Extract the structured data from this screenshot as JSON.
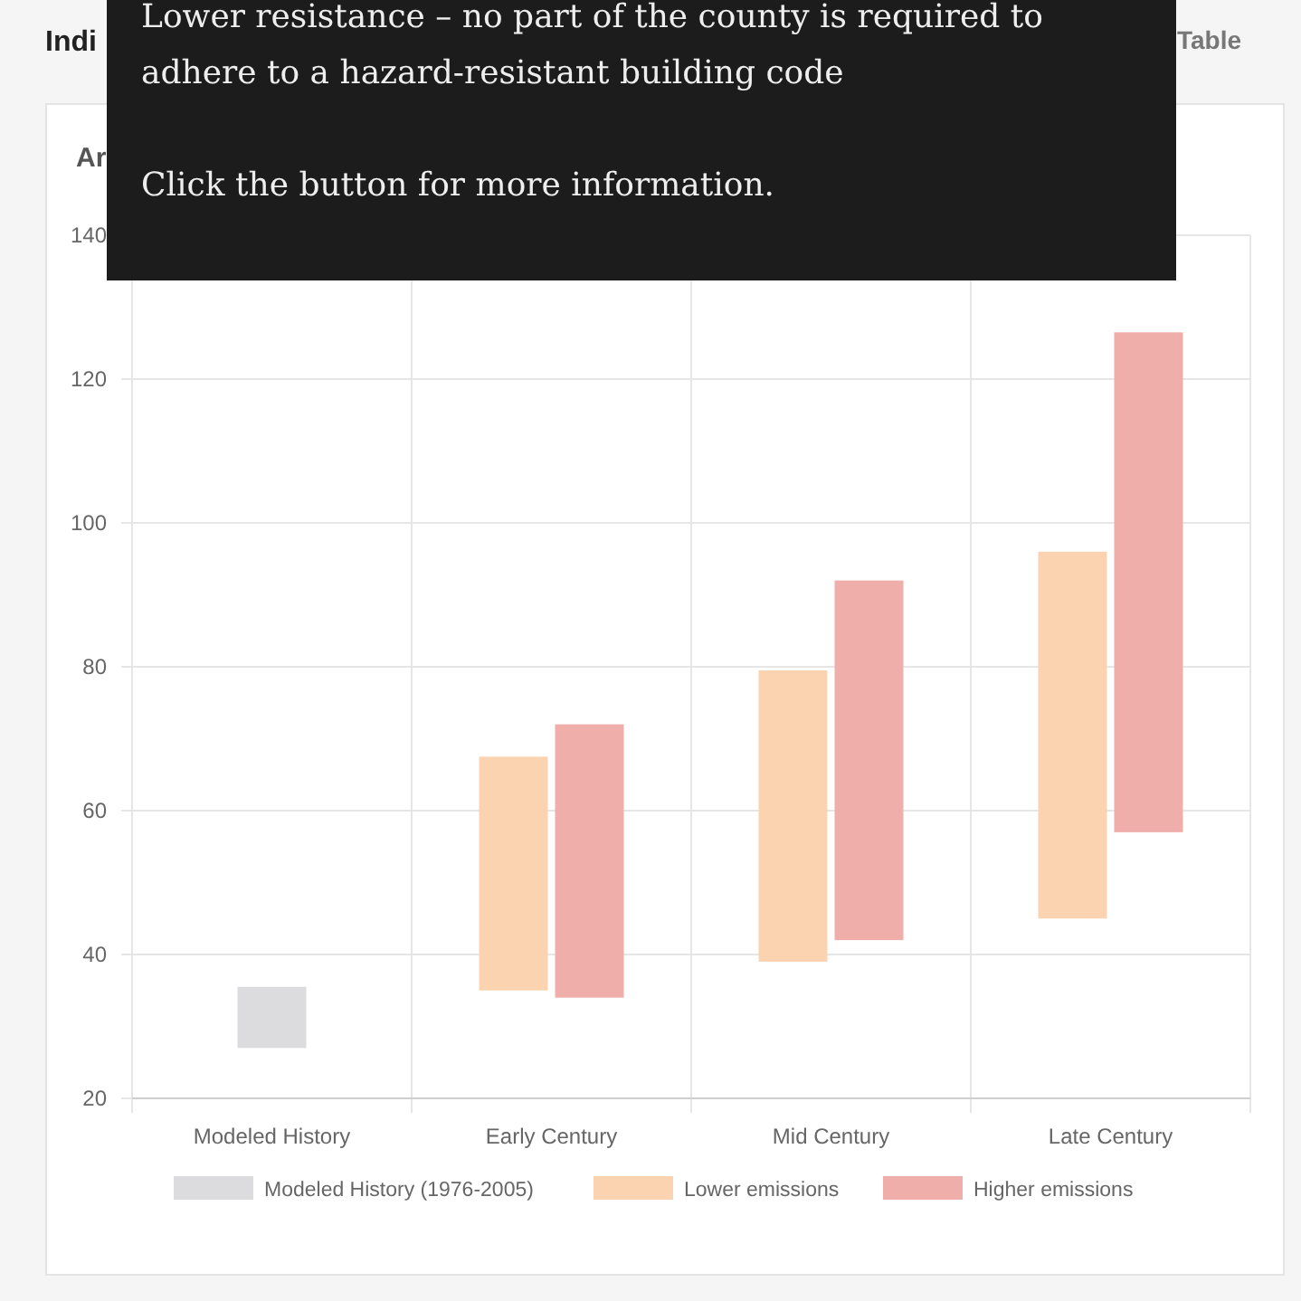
{
  "header": {
    "title": "Indi",
    "tab": "Table"
  },
  "tooltip": {
    "lines": [
      "Lower resistance – no part of the county is required to adhere to a hazard-resistant building code",
      "Click the button for more information."
    ]
  },
  "card": {
    "title": "Ar",
    "chart_data": {
      "type": "candlestick",
      "categories": [
        "Modeled History",
        "Early Century",
        "Mid Century",
        "Late Century"
      ],
      "ylim": [
        20,
        140
      ],
      "yticks": [
        20,
        40,
        60,
        80,
        100,
        120,
        140
      ],
      "grid": true,
      "legend": "bottom",
      "series": [
        {
          "name": "Modeled History (1976-2005)",
          "color": "#dcdcdf",
          "ohlc": [
            [
              27,
              35.5,
              27,
              35.5
            ],
            null,
            null,
            null
          ]
        },
        {
          "name": "Lower emissions",
          "color": "#fbd3b0",
          "ohlc": [
            null,
            [
              35,
              67.5,
              35,
              67.5
            ],
            [
              39,
              79.5,
              39,
              79.5
            ],
            [
              45,
              96,
              45,
              96
            ]
          ]
        },
        {
          "name": "Higher emissions",
          "color": "#f0aeaa",
          "ohlc": [
            null,
            [
              34,
              72,
              34,
              72
            ],
            [
              42,
              92,
              42,
              92
            ],
            [
              57,
              126.5,
              57,
              126.5
            ]
          ]
        }
      ]
    }
  }
}
